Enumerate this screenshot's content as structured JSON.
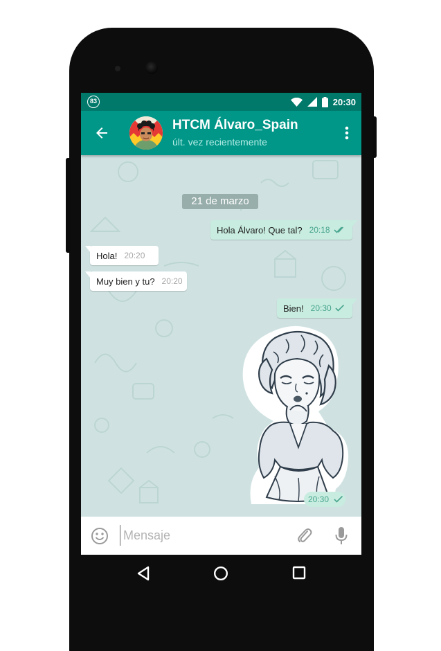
{
  "status_bar": {
    "notification_count": "83",
    "time": "20:30",
    "icons": [
      "wifi-icon",
      "signal-icon",
      "battery-icon"
    ]
  },
  "app_bar": {
    "back_icon": "arrow-back-icon",
    "title": "HTCM Álvaro_Spain",
    "subtitle": "últ. vez recientemente",
    "menu_icon": "more-vert-icon"
  },
  "chat": {
    "date": "21 de marzo",
    "messages": [
      {
        "direction": "out",
        "text": "Hola Álvaro! Que tal?",
        "time": "20:18",
        "status": "read"
      },
      {
        "direction": "in",
        "text": "Hola!",
        "time": "20:20"
      },
      {
        "direction": "in",
        "text": "Muy bien y tu?",
        "time": "20:20"
      },
      {
        "direction": "out",
        "text": "Bien!",
        "time": "20:30",
        "status": "sent"
      },
      {
        "direction": "out",
        "type": "sticker",
        "sticker": "marilyn-sticker",
        "time": "20:30",
        "status": "sent"
      }
    ]
  },
  "input_bar": {
    "placeholder": "Mensaje",
    "value": "",
    "icons": [
      "emoji-icon",
      "attach-icon",
      "mic-icon"
    ]
  },
  "nav_bar": {
    "icons": [
      "back-triangle-icon",
      "home-circle-icon",
      "recents-square-icon"
    ]
  },
  "colors": {
    "status_bar": "#00796b",
    "app_bar": "#009688",
    "chat_background": "#cfe2e1",
    "outgoing_bubble": "#c8ecdf",
    "incoming_bubble": "#ffffff",
    "accent_time": "#48a58f"
  }
}
